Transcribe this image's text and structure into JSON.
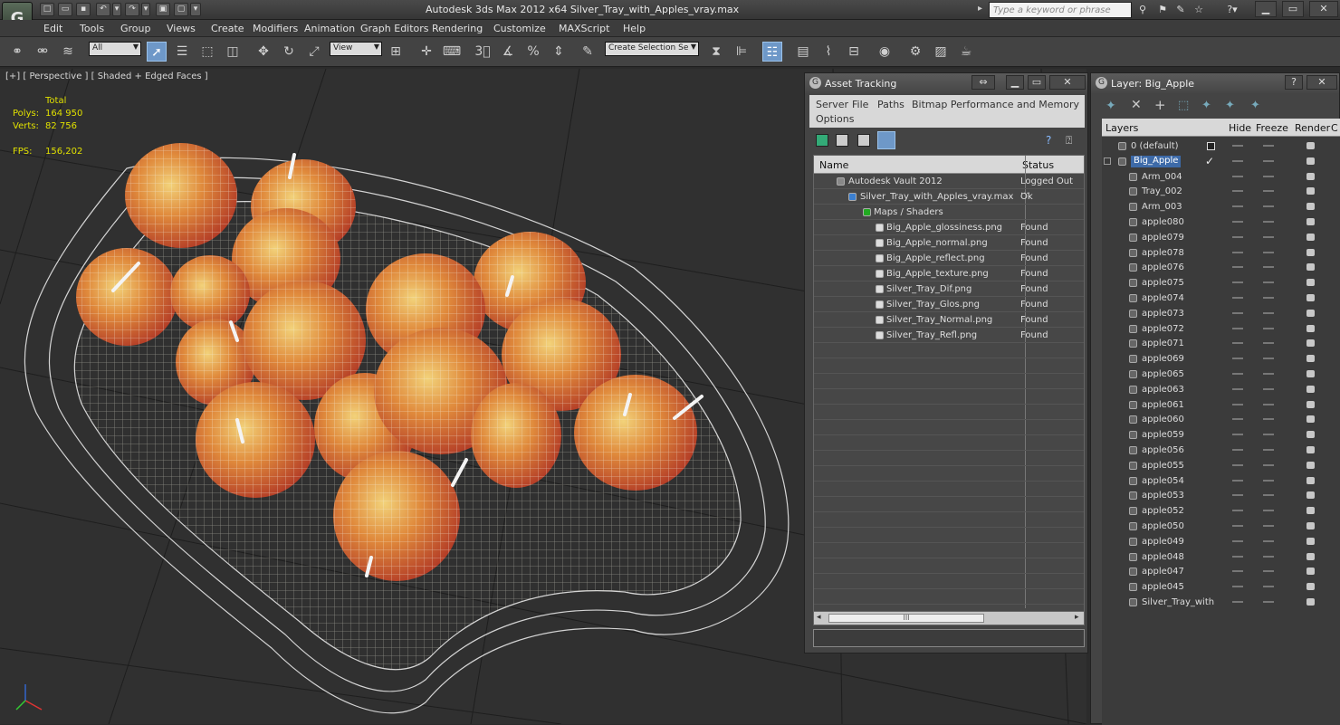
{
  "app": {
    "title": "Autodesk 3ds Max  2012 x64     Silver_Tray_with_Apples_vray.max",
    "logo": "G",
    "search_placeholder": "Type a keyword or phrase"
  },
  "menu": [
    "Edit",
    "Tools",
    "Group",
    "Views",
    "Create",
    "Modifiers",
    "Animation",
    "Graph Editors",
    "Rendering",
    "Customize",
    "MAXScript",
    "Help"
  ],
  "toolbar": {
    "filter_value": "All",
    "refcoord_value": "View",
    "selection_set_value": "Create Selection Se"
  },
  "viewport": {
    "label": "[+] [ Perspective ] [ Shaded + Edged Faces ]",
    "stats": {
      "total_label": "Total",
      "polys_label": "Polys:",
      "polys_value": "164 950",
      "verts_label": "Verts:",
      "verts_value": "82 756",
      "fps_label": "FPS:",
      "fps_value": "156,202"
    }
  },
  "asset_tracking": {
    "title": "Asset Tracking",
    "menu": [
      "Server",
      "File",
      "Paths",
      "Bitmap Performance and Memory",
      "Options"
    ],
    "columns": {
      "name": "Name",
      "status": "Status"
    },
    "rows": [
      {
        "name": "Autodesk Vault 2012",
        "status": "Logged Out ..."
      },
      {
        "name": "Silver_Tray_with_Apples_vray.max",
        "status": "Ok"
      },
      {
        "name": "Maps / Shaders",
        "status": ""
      },
      {
        "name": "Big_Apple_glossiness.png",
        "status": "Found"
      },
      {
        "name": "Big_Apple_normal.png",
        "status": "Found"
      },
      {
        "name": "Big_Apple_reflect.png",
        "status": "Found"
      },
      {
        "name": "Big_Apple_texture.png",
        "status": "Found"
      },
      {
        "name": "Silver_Tray_Dif.png",
        "status": "Found"
      },
      {
        "name": "Silver_Tray_Glos.png",
        "status": "Found"
      },
      {
        "name": "Silver_Tray_Normal.png",
        "status": "Found"
      },
      {
        "name": "Silver_Tray_Refl.png",
        "status": "Found"
      }
    ],
    "scroll_grip": "III"
  },
  "layer_panel": {
    "title": "Layer: Big_Apple",
    "columns": {
      "layers": "Layers",
      "hide": "Hide",
      "freeze": "Freeze",
      "render": "Render",
      "c": "C"
    },
    "rows": [
      "0 (default)",
      "Big_Apple",
      "Arm_004",
      "Tray_002",
      "Arm_003",
      "apple080",
      "apple079",
      "apple078",
      "apple076",
      "apple075",
      "apple074",
      "apple073",
      "apple072",
      "apple071",
      "apple069",
      "apple065",
      "apple063",
      "apple061",
      "apple060",
      "apple059",
      "apple056",
      "apple055",
      "apple054",
      "apple053",
      "apple052",
      "apple050",
      "apple049",
      "apple048",
      "apple047",
      "apple045",
      "Silver_Tray_with"
    ],
    "selected_row": "Big_Apple"
  }
}
